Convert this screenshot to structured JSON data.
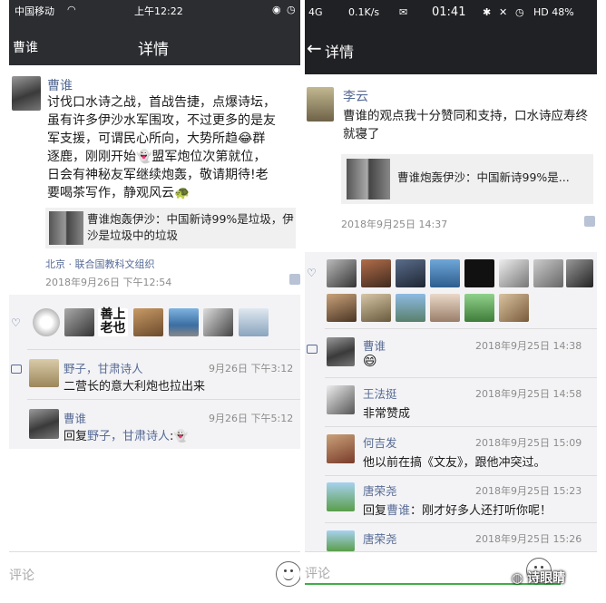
{
  "left": {
    "status": {
      "carrier": "中国移动",
      "time": "上午12:22"
    },
    "header": {
      "back_label": "曹谁",
      "title": "详情"
    },
    "post": {
      "author": "曹谁",
      "lines": [
        "讨伐口水诗之战，首战告捷，点爆诗坛，",
        "虽有许多伊沙水军围攻，不过更多的是友",
        "军支援，可谓民心所向，大势所趋😂群",
        "逐鹿，刚刚开始👻盟军炮位次第就位，",
        "日会有神秘友军继续炮轰，敬请期待!老",
        "要喝茶写作，静观风云🐢"
      ],
      "share_text": "曹谁炮轰伊沙：中国新诗99%是垃圾，伊沙是垃圾中的垃圾",
      "location": "北京 · 联合国教科文组织",
      "time": "2018年9月26日 下午12:54"
    },
    "like_calligraphy": "善上老也",
    "comments": [
      {
        "name": "野子，甘肃诗人",
        "time": "9月26日 下午3:12",
        "text": "二营长的意大利炮也拉出来"
      },
      {
        "name": "曹谁",
        "time": "9月26日 下午5:12",
        "reply_prefix": "回复",
        "reply_to": "野子，甘肃诗人",
        "reply_suffix": ":👻"
      }
    ],
    "input_placeholder": "评论"
  },
  "right": {
    "status": {
      "net": "4G",
      "speed": "0.1K/s",
      "time": "01:41",
      "battery": "HD 48%"
    },
    "header": {
      "title": "详情"
    },
    "post": {
      "author": "李云",
      "lines": [
        "曹谁的观点我十分赞同和支持，口水诗应寿终",
        "就寝了"
      ],
      "share_text": "曹谁炮轰伊沙：中国新诗99%是...",
      "time": "2018年9月25日 14:37"
    },
    "comments": [
      {
        "name": "曹谁",
        "time": "2018年9月25日 14:38",
        "text": "😄"
      },
      {
        "name": "王法挺",
        "time": "2018年9月25日 14:58",
        "text": "非常赞成"
      },
      {
        "name": "何吉发",
        "time": "2018年9月25日 15:09",
        "text": "他以前在搞《文友》，跟他冲突过。"
      },
      {
        "name": "唐荣尧",
        "time": "2018年9月25日 15:23",
        "reply_prefix": "回复",
        "reply_to": "曹谁",
        "reply_suffix": "：刚才好多人还打听你呢！"
      },
      {
        "name": "唐荣尧",
        "time": "2018年9月25日 15:26"
      }
    ],
    "input_placeholder": "评论",
    "watermark": "诗眼睛"
  },
  "colors": {
    "bar": "#2b2d31",
    "link": "#576b95",
    "panel": "#f3f3f5"
  }
}
